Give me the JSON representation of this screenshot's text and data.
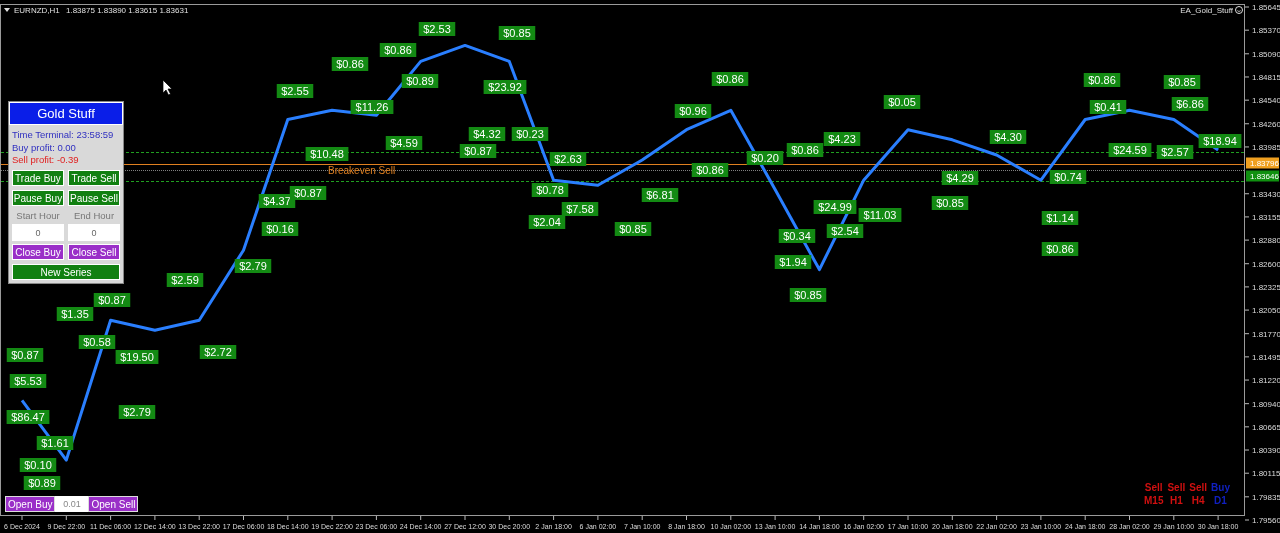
{
  "chart_header": {
    "symbol": "EURNZD,H1",
    "ohlc": "1.83875 1.83890 1.83615 1.83631",
    "expert": "EA_Gold_Stuff"
  },
  "panel": {
    "title": "Gold Stuff",
    "time": "Time Terminal: 23:58:59",
    "buy_profit": "Buy profit: 0.00",
    "sell_profit": "Sell profit: -0.39",
    "buttons": [
      {
        "label": "Trade Buy",
        "kind": "green"
      },
      {
        "label": "Trade Sell",
        "kind": "green"
      },
      {
        "label": "Pause Buy",
        "kind": "green"
      },
      {
        "label": "Pause Sell",
        "kind": "green"
      }
    ],
    "hours": [
      {
        "label": "Start Hour",
        "value": "0"
      },
      {
        "label": "End Hour",
        "value": "0"
      }
    ],
    "close_buttons": [
      {
        "label": "Close Buy",
        "kind": "purple"
      },
      {
        "label": "Close Sell",
        "kind": "purple"
      }
    ],
    "series_button": {
      "label": "New Series",
      "kind": "green"
    }
  },
  "order_bar": {
    "buy": "Open Buy",
    "lot": "0.01",
    "sell": "Open Sell"
  },
  "signals": [
    {
      "signal": "Sell",
      "timeframe": "M15",
      "color": "#d01010"
    },
    {
      "signal": "Sell",
      "timeframe": "H1",
      "color": "#d01010"
    },
    {
      "signal": "Sell",
      "timeframe": "H4",
      "color": "#d01010"
    },
    {
      "signal": "Buy",
      "timeframe": "D1",
      "color": "#1020c0"
    }
  ],
  "price_tags": [
    {
      "text": "1.83796",
      "color": "#f0a020"
    },
    {
      "text": "1.83646",
      "color": "#109010"
    }
  ],
  "breakeven_label": "Breakeven Sell",
  "trade_labels": [
    "$0.87",
    "$5.53",
    "$86.47",
    "$0.89",
    "$1.61",
    "$0.10",
    "$0.87",
    "$1.35",
    "$0.58",
    "$19.50",
    "$2.79",
    "$2.59",
    "$2.72",
    "$2.79",
    "$4.37",
    "$0.16",
    "$0.87",
    "$10.48",
    "$2.55",
    "$11.26",
    "$4.59",
    "$0.86",
    "$0.86",
    "$0.89",
    "$2.53",
    "$0.85",
    "$23.92",
    "$4.32",
    "$0.87",
    "$0.23",
    "$2.63",
    "$0.78",
    "$7.58",
    "$2.04",
    "$6.81",
    "$0.85",
    "$0.86",
    "$0.96",
    "$0.86",
    "$0.20",
    "$0.86",
    "$24.99",
    "$11.03",
    "$2.54",
    "$0.34",
    "$1.94",
    "$0.85",
    "$0.05",
    "$4.23",
    "$0.85",
    "$4.30",
    "$4.29",
    "$1.14",
    "$0.86",
    "$0.74",
    "$0.86",
    "$0.41",
    "$24.59",
    "$2.57",
    "$0.85",
    "$6.86",
    "$18.94"
  ],
  "chart": {
    "chart_data": {
      "type": "line",
      "categories": [
        "6 Dec 2024",
        "9 Dec 22:00",
        "11 Dec 06:00",
        "12 Dec 14:00",
        "13 Dec 22:00",
        "17 Dec 06:00",
        "18 Dec 14:00",
        "19 Dec 22:00",
        "23 Dec 06:00",
        "24 Dec 14:00",
        "27 Dec 12:00",
        "30 Dec 20:00",
        "2 Jan 18:00",
        "6 Jan 02:00",
        "7 Jan 10:00",
        "8 Jan 18:00",
        "10 Jan 02:00",
        "13 Jan 10:00",
        "14 Jan 18:00",
        "16 Jan 02:00",
        "17 Jan 10:00",
        "20 Jan 18:00",
        "22 Jan 02:00",
        "23 Jan 10:00",
        "24 Jan 18:00",
        "28 Jan 02:00",
        "29 Jan 10:00",
        "30 Jan 18:00"
      ],
      "series": [
        {
          "color": "#2a7fff",
          "values": [
            1.8098,
            1.8027,
            1.8193,
            1.8181,
            1.8193,
            1.8276,
            1.8431,
            1.8442,
            1.8436,
            1.85,
            1.8519,
            1.85,
            1.8359,
            1.8353,
            1.8383,
            1.8419,
            1.8442,
            1.8348,
            1.8253,
            1.8359,
            1.8419,
            1.8407,
            1.8389,
            1.8359,
            1.8431,
            1.8442,
            1.8431,
            1.8395
          ]
        }
      ],
      "ylim": [
        1.7956,
        1.85645
      ],
      "yticks": [
        {
          "value": 1.85645,
          "label": "1.85645"
        },
        {
          "value": 1.8537,
          "label": "1.85370"
        },
        {
          "value": 1.8509,
          "label": "1.85090"
        },
        {
          "value": 1.84815,
          "label": "1.84815"
        },
        {
          "value": 1.8454,
          "label": "1.84540"
        },
        {
          "value": 1.8426,
          "label": "1.84260"
        },
        {
          "value": 1.83985,
          "label": "1.83985"
        },
        {
          "value": 1.8343,
          "label": "1.83430"
        },
        {
          "value": 1.83155,
          "label": "1.83155"
        },
        {
          "value": 1.8288,
          "label": "1.82880"
        },
        {
          "value": 1.826,
          "label": "1.82600"
        },
        {
          "value": 1.82325,
          "label": "1.82325"
        },
        {
          "value": 1.8205,
          "label": "1.82050"
        },
        {
          "value": 1.8177,
          "label": "1.81770"
        },
        {
          "value": 1.81495,
          "label": "1.81495"
        },
        {
          "value": 1.8122,
          "label": "1.81220"
        },
        {
          "value": 1.8094,
          "label": "1.80940"
        },
        {
          "value": 1.80665,
          "label": "1.80665"
        },
        {
          "value": 1.8039,
          "label": "1.80390"
        },
        {
          "value": 1.80115,
          "label": "1.80115"
        },
        {
          "value": 1.79835,
          "label": "1.79835"
        },
        {
          "value": 1.7956,
          "label": "1.79560"
        }
      ]
    }
  }
}
